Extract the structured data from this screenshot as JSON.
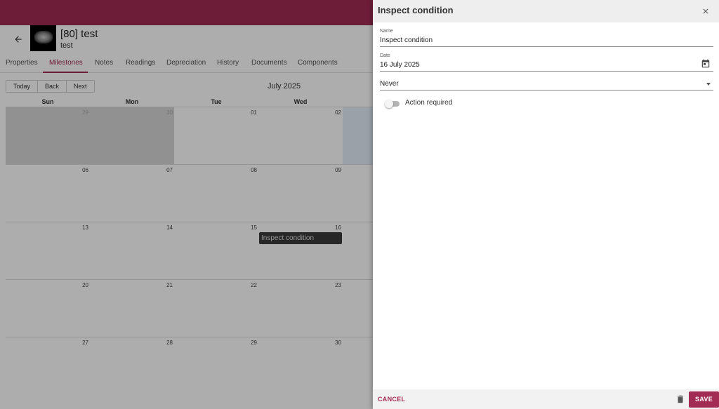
{
  "asset": {
    "title": "[80] test",
    "subtitle": "test"
  },
  "tabs": [
    "Properties",
    "Milestones",
    "Notes",
    "Readings",
    "Depreciation",
    "History",
    "Documents",
    "Components"
  ],
  "active_tab": "Milestones",
  "calendar": {
    "nav": {
      "today": "Today",
      "back": "Back",
      "next": "Next"
    },
    "month_label": "July 2025",
    "weekdays": [
      "Sun",
      "Mon",
      "Tue",
      "Wed"
    ],
    "weeks": [
      [
        "29",
        "30",
        "01",
        "02"
      ],
      [
        "06",
        "07",
        "08",
        "09"
      ],
      [
        "13",
        "14",
        "15",
        "16"
      ],
      [
        "20",
        "21",
        "22",
        "23"
      ],
      [
        "27",
        "28",
        "29",
        "30"
      ]
    ],
    "event": {
      "label": "Inspect condition",
      "day": "16"
    }
  },
  "panel": {
    "title": "Inspect condition",
    "name_label": "Name",
    "name_value": "Inspect condition",
    "date_label": "Date",
    "date_value": "16 July 2025",
    "repeat_value": "Never",
    "action_required_label": "Action required",
    "action_required": false,
    "cancel_label": "CANCEL",
    "save_label": "SAVE"
  },
  "colors": {
    "accent": "#a32c55",
    "panel_header": "#eeeeee"
  }
}
